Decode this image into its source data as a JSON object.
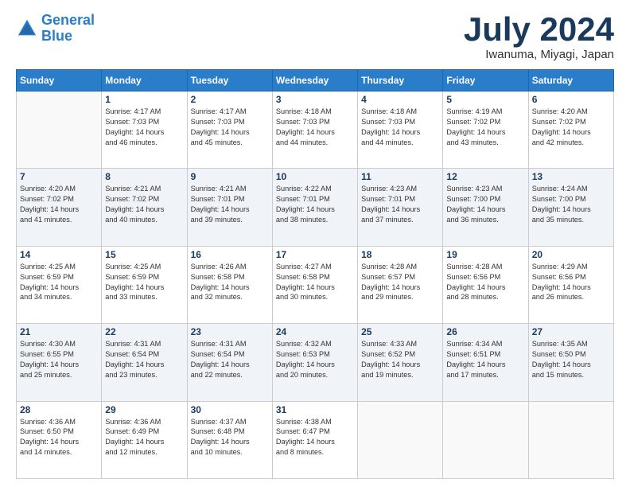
{
  "header": {
    "logo_line1": "General",
    "logo_line2": "Blue",
    "month": "July 2024",
    "location": "Iwanuma, Miyagi, Japan"
  },
  "days_of_week": [
    "Sunday",
    "Monday",
    "Tuesday",
    "Wednesday",
    "Thursday",
    "Friday",
    "Saturday"
  ],
  "weeks": [
    [
      {
        "day": "",
        "info": ""
      },
      {
        "day": "1",
        "info": "Sunrise: 4:17 AM\nSunset: 7:03 PM\nDaylight: 14 hours\nand 46 minutes."
      },
      {
        "day": "2",
        "info": "Sunrise: 4:17 AM\nSunset: 7:03 PM\nDaylight: 14 hours\nand 45 minutes."
      },
      {
        "day": "3",
        "info": "Sunrise: 4:18 AM\nSunset: 7:03 PM\nDaylight: 14 hours\nand 44 minutes."
      },
      {
        "day": "4",
        "info": "Sunrise: 4:18 AM\nSunset: 7:03 PM\nDaylight: 14 hours\nand 44 minutes."
      },
      {
        "day": "5",
        "info": "Sunrise: 4:19 AM\nSunset: 7:02 PM\nDaylight: 14 hours\nand 43 minutes."
      },
      {
        "day": "6",
        "info": "Sunrise: 4:20 AM\nSunset: 7:02 PM\nDaylight: 14 hours\nand 42 minutes."
      }
    ],
    [
      {
        "day": "7",
        "info": "Sunrise: 4:20 AM\nSunset: 7:02 PM\nDaylight: 14 hours\nand 41 minutes."
      },
      {
        "day": "8",
        "info": "Sunrise: 4:21 AM\nSunset: 7:02 PM\nDaylight: 14 hours\nand 40 minutes."
      },
      {
        "day": "9",
        "info": "Sunrise: 4:21 AM\nSunset: 7:01 PM\nDaylight: 14 hours\nand 39 minutes."
      },
      {
        "day": "10",
        "info": "Sunrise: 4:22 AM\nSunset: 7:01 PM\nDaylight: 14 hours\nand 38 minutes."
      },
      {
        "day": "11",
        "info": "Sunrise: 4:23 AM\nSunset: 7:01 PM\nDaylight: 14 hours\nand 37 minutes."
      },
      {
        "day": "12",
        "info": "Sunrise: 4:23 AM\nSunset: 7:00 PM\nDaylight: 14 hours\nand 36 minutes."
      },
      {
        "day": "13",
        "info": "Sunrise: 4:24 AM\nSunset: 7:00 PM\nDaylight: 14 hours\nand 35 minutes."
      }
    ],
    [
      {
        "day": "14",
        "info": "Sunrise: 4:25 AM\nSunset: 6:59 PM\nDaylight: 14 hours\nand 34 minutes."
      },
      {
        "day": "15",
        "info": "Sunrise: 4:25 AM\nSunset: 6:59 PM\nDaylight: 14 hours\nand 33 minutes."
      },
      {
        "day": "16",
        "info": "Sunrise: 4:26 AM\nSunset: 6:58 PM\nDaylight: 14 hours\nand 32 minutes."
      },
      {
        "day": "17",
        "info": "Sunrise: 4:27 AM\nSunset: 6:58 PM\nDaylight: 14 hours\nand 30 minutes."
      },
      {
        "day": "18",
        "info": "Sunrise: 4:28 AM\nSunset: 6:57 PM\nDaylight: 14 hours\nand 29 minutes."
      },
      {
        "day": "19",
        "info": "Sunrise: 4:28 AM\nSunset: 6:56 PM\nDaylight: 14 hours\nand 28 minutes."
      },
      {
        "day": "20",
        "info": "Sunrise: 4:29 AM\nSunset: 6:56 PM\nDaylight: 14 hours\nand 26 minutes."
      }
    ],
    [
      {
        "day": "21",
        "info": "Sunrise: 4:30 AM\nSunset: 6:55 PM\nDaylight: 14 hours\nand 25 minutes."
      },
      {
        "day": "22",
        "info": "Sunrise: 4:31 AM\nSunset: 6:54 PM\nDaylight: 14 hours\nand 23 minutes."
      },
      {
        "day": "23",
        "info": "Sunrise: 4:31 AM\nSunset: 6:54 PM\nDaylight: 14 hours\nand 22 minutes."
      },
      {
        "day": "24",
        "info": "Sunrise: 4:32 AM\nSunset: 6:53 PM\nDaylight: 14 hours\nand 20 minutes."
      },
      {
        "day": "25",
        "info": "Sunrise: 4:33 AM\nSunset: 6:52 PM\nDaylight: 14 hours\nand 19 minutes."
      },
      {
        "day": "26",
        "info": "Sunrise: 4:34 AM\nSunset: 6:51 PM\nDaylight: 14 hours\nand 17 minutes."
      },
      {
        "day": "27",
        "info": "Sunrise: 4:35 AM\nSunset: 6:50 PM\nDaylight: 14 hours\nand 15 minutes."
      }
    ],
    [
      {
        "day": "28",
        "info": "Sunrise: 4:36 AM\nSunset: 6:50 PM\nDaylight: 14 hours\nand 14 minutes."
      },
      {
        "day": "29",
        "info": "Sunrise: 4:36 AM\nSunset: 6:49 PM\nDaylight: 14 hours\nand 12 minutes."
      },
      {
        "day": "30",
        "info": "Sunrise: 4:37 AM\nSunset: 6:48 PM\nDaylight: 14 hours\nand 10 minutes."
      },
      {
        "day": "31",
        "info": "Sunrise: 4:38 AM\nSunset: 6:47 PM\nDaylight: 14 hours\nand 8 minutes."
      },
      {
        "day": "",
        "info": ""
      },
      {
        "day": "",
        "info": ""
      },
      {
        "day": "",
        "info": ""
      }
    ]
  ]
}
